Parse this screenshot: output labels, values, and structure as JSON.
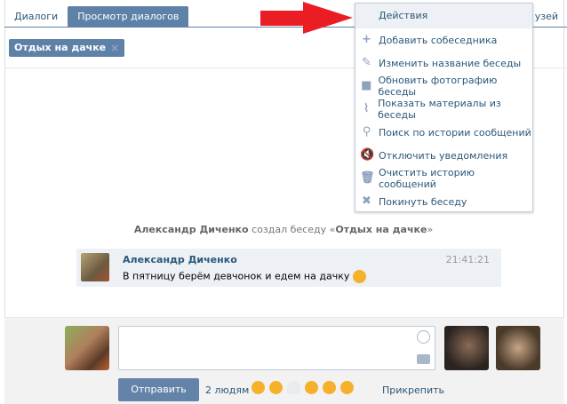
{
  "tabs": {
    "dialogs": "Диалоги",
    "view": "Просмотр диалогов",
    "right": "узей"
  },
  "chip": {
    "label": "Отдых на дачке",
    "close_icon": "×"
  },
  "system": {
    "author": "Александр Диченко",
    "action": " создал беседу ",
    "quote_open": "«",
    "title": "Отдых на дачке",
    "quote_close": "»"
  },
  "message": {
    "author": "Александр Диченко",
    "time": "21:41:21",
    "text": "В пятницу берём девчонок и едем на дачку"
  },
  "composer": {
    "send": "Отправить",
    "recipients": "2 людям",
    "attach": "Прикрепить"
  },
  "menu": {
    "header": "Действия",
    "items": [
      {
        "label": "Добавить собеседника",
        "icon": "+"
      },
      {
        "label": "Изменить название беседы",
        "icon": "✎"
      },
      {
        "label": "Обновить фотографию беседы",
        "icon": "■"
      },
      {
        "label": "Показать материалы из беседы",
        "icon": "⌇"
      },
      {
        "label": "Поиск по истории сообщений",
        "icon": "⚲"
      },
      {
        "label": "Отключить уведомления",
        "icon": "🔇"
      },
      {
        "label": "Очистить историю сообщений",
        "icon": "🗑"
      },
      {
        "label": "Покинуть беседу",
        "icon": "✖"
      }
    ]
  },
  "colors": {
    "accent": "#5e81a8",
    "arrow": "#ea1c24",
    "link": "#2b587a"
  }
}
